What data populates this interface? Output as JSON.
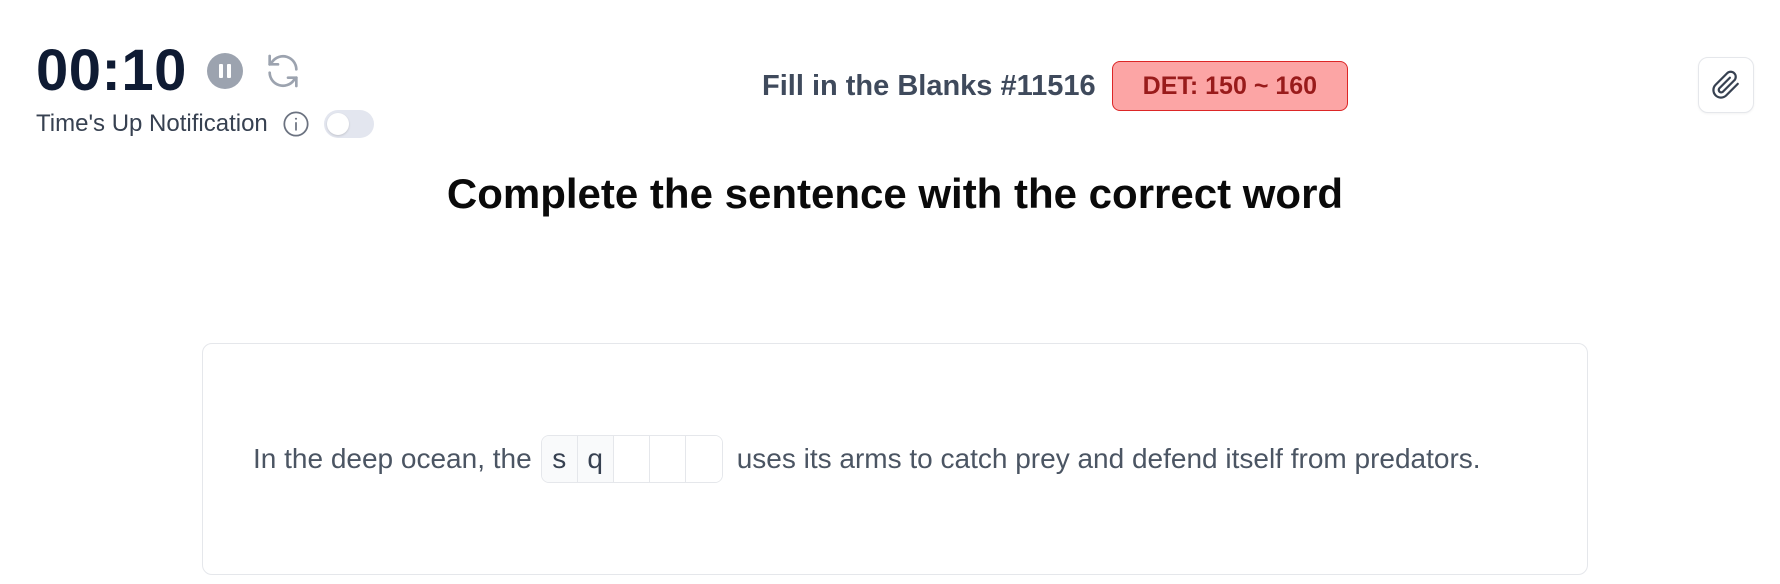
{
  "timer": {
    "time": "00:10",
    "pause_icon": "pause-icon",
    "reset_icon": "refresh-icon"
  },
  "notification": {
    "label": "Time's Up Notification",
    "info_icon": "info-icon",
    "enabled": false
  },
  "header": {
    "title": "Fill in the Blanks #11516",
    "badge": "DET: 150 ~ 160",
    "attach_icon": "paperclip-icon"
  },
  "question": {
    "heading": "Complete the sentence with the correct word",
    "before": "In the deep ocean, the",
    "letters": [
      "s",
      "q",
      "",
      "",
      ""
    ],
    "after": "uses its arms to catch prey and defend itself from predators."
  },
  "colors": {
    "timer_text": "#0f1b33",
    "badge_bg": "#fca5a5",
    "badge_border": "#dc2626",
    "badge_text": "#991b1b"
  }
}
